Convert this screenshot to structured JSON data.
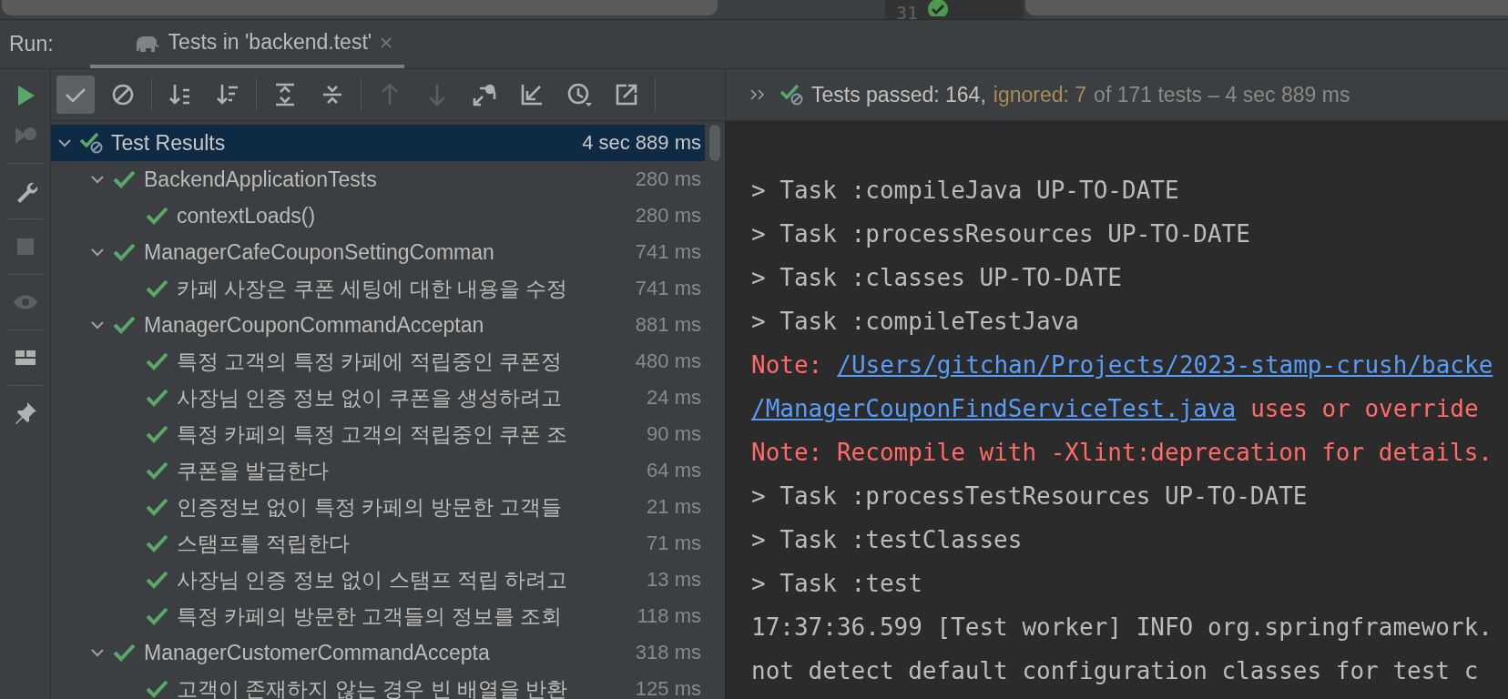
{
  "editor_strip": {
    "line_number": "31"
  },
  "run_bar": {
    "label": "Run:",
    "tabs": [
      {
        "label": "Tests in 'backend.test'",
        "selected": true
      }
    ]
  },
  "side_actions": [
    {
      "kind": "run",
      "disabled": false
    },
    {
      "kind": "rerun-failed",
      "disabled": true
    },
    {
      "kind": "settings",
      "disabled": false
    },
    {
      "kind": "stop",
      "disabled": true
    },
    {
      "kind": "eye",
      "disabled": true
    },
    {
      "kind": "layout",
      "disabled": false
    },
    {
      "kind": "pin",
      "disabled": false
    }
  ],
  "toolbar": [
    {
      "kind": "show-passed",
      "selected": true,
      "disabled": false
    },
    {
      "kind": "show-ignored",
      "selected": false,
      "disabled": false
    },
    {
      "kind": "sort-alpha",
      "selected": false,
      "disabled": false
    },
    {
      "kind": "sort-duration",
      "selected": false,
      "disabled": false
    },
    {
      "kind": "expand-all",
      "selected": false,
      "disabled": false
    },
    {
      "kind": "collapse-all",
      "selected": false,
      "disabled": false
    },
    {
      "kind": "previous",
      "selected": false,
      "disabled": true
    },
    {
      "kind": "next",
      "selected": false,
      "disabled": true
    },
    {
      "kind": "import",
      "selected": false,
      "disabled": false
    },
    {
      "kind": "import-corner",
      "selected": false,
      "disabled": false
    },
    {
      "kind": "history",
      "selected": false,
      "disabled": false
    },
    {
      "kind": "export",
      "selected": false,
      "disabled": false
    }
  ],
  "status": {
    "ignored": true,
    "segments": [
      {
        "kind": "passed",
        "text": "Tests passed: 164,"
      },
      {
        "kind": "ignored",
        "text": "ignored: 7"
      },
      {
        "kind": "summary",
        "text": "of 171 tests – 4 sec 889 ms"
      }
    ]
  },
  "tree": {
    "name": "Test Results",
    "time": "4 sec 889 ms",
    "ignored": true,
    "selected": true,
    "expanded": true,
    "children": [
      {
        "name": "BackendApplicationTests",
        "time": "280 ms",
        "ignored": false,
        "selected": false,
        "expanded": true,
        "children": [
          {
            "name": "contextLoads()",
            "time": "280 ms",
            "ignored": false,
            "selected": false
          }
        ]
      },
      {
        "name": "ManagerCafeCouponSettingComman",
        "time": "741 ms",
        "ignored": false,
        "selected": false,
        "expanded": true,
        "children": [
          {
            "name": "카페 사장은 쿠폰 세팅에 대한 내용을 수정",
            "time": "741 ms",
            "ignored": false,
            "selected": false
          }
        ]
      },
      {
        "name": "ManagerCouponCommandAcceptan",
        "time": "881 ms",
        "ignored": false,
        "selected": false,
        "expanded": true,
        "children": [
          {
            "name": "특정 고객의 특정 카페에 적립중인 쿠폰정",
            "time": "480 ms",
            "ignored": false,
            "selected": false
          },
          {
            "name": "사장님 인증 정보 없이 쿠폰을 생성하려고",
            "time": "24 ms",
            "ignored": false,
            "selected": false
          },
          {
            "name": "특정 카페의 특정 고객의 적립중인 쿠폰 조",
            "time": "90 ms",
            "ignored": false,
            "selected": false
          },
          {
            "name": "쿠폰을 발급한다",
            "time": "64 ms",
            "ignored": false,
            "selected": false
          },
          {
            "name": "인증정보 없이 특정 카페의 방문한 고객들",
            "time": "21 ms",
            "ignored": false,
            "selected": false
          },
          {
            "name": "스탬프를 적립한다",
            "time": "71 ms",
            "ignored": false,
            "selected": false
          },
          {
            "name": "사장님 인증 정보 없이 스탬프 적립 하려고",
            "time": "13 ms",
            "ignored": false,
            "selected": false
          },
          {
            "name": "특정 카페의 방문한 고객들의 정보를 조회",
            "time": "118 ms",
            "ignored": false,
            "selected": false
          }
        ]
      },
      {
        "name": "ManagerCustomerCommandAccepta",
        "time": "318 ms",
        "ignored": false,
        "selected": false,
        "expanded": true,
        "children": [
          {
            "name": "고객이 존재하지 않는 경우 빈 배열을 반환",
            "time": "125 ms",
            "ignored": false,
            "selected": false
          }
        ]
      }
    ]
  },
  "console": [
    {
      "segments": [
        {
          "kind": "plain",
          "text": "> Task :compileJava UP-TO-DATE"
        }
      ]
    },
    {
      "segments": [
        {
          "kind": "plain",
          "text": "> Task :processResources UP-TO-DATE"
        }
      ]
    },
    {
      "segments": [
        {
          "kind": "plain",
          "text": "> Task :classes UP-TO-DATE"
        }
      ]
    },
    {
      "segments": [
        {
          "kind": "plain",
          "text": "> Task :compileTestJava"
        }
      ]
    },
    {
      "segments": [
        {
          "kind": "error",
          "text": "Note:"
        },
        {
          "kind": "link",
          "text": "/Users/gitchan/Projects/2023-stamp-crush/backe"
        }
      ]
    },
    {
      "segments": [
        {
          "kind": "link",
          "text": "/ManagerCouponFindServiceTest.java"
        },
        {
          "kind": "error",
          "text": "uses or override"
        }
      ]
    },
    {
      "segments": [
        {
          "kind": "error",
          "text": "Note: Recompile with -Xlint:deprecation for details."
        }
      ]
    },
    {
      "segments": [
        {
          "kind": "plain",
          "text": "> Task :processTestResources UP-TO-DATE"
        }
      ]
    },
    {
      "segments": [
        {
          "kind": "plain",
          "text": "> Task :testClasses"
        }
      ]
    },
    {
      "segments": [
        {
          "kind": "plain",
          "text": "> Task :test"
        }
      ]
    },
    {
      "segments": [
        {
          "kind": "plain",
          "text": "17:37:36.599 [Test worker] INFO org.springframework."
        }
      ]
    },
    {
      "segments": [
        {
          "kind": "plain",
          "text": "not detect default configuration classes for test c"
        }
      ]
    }
  ]
}
